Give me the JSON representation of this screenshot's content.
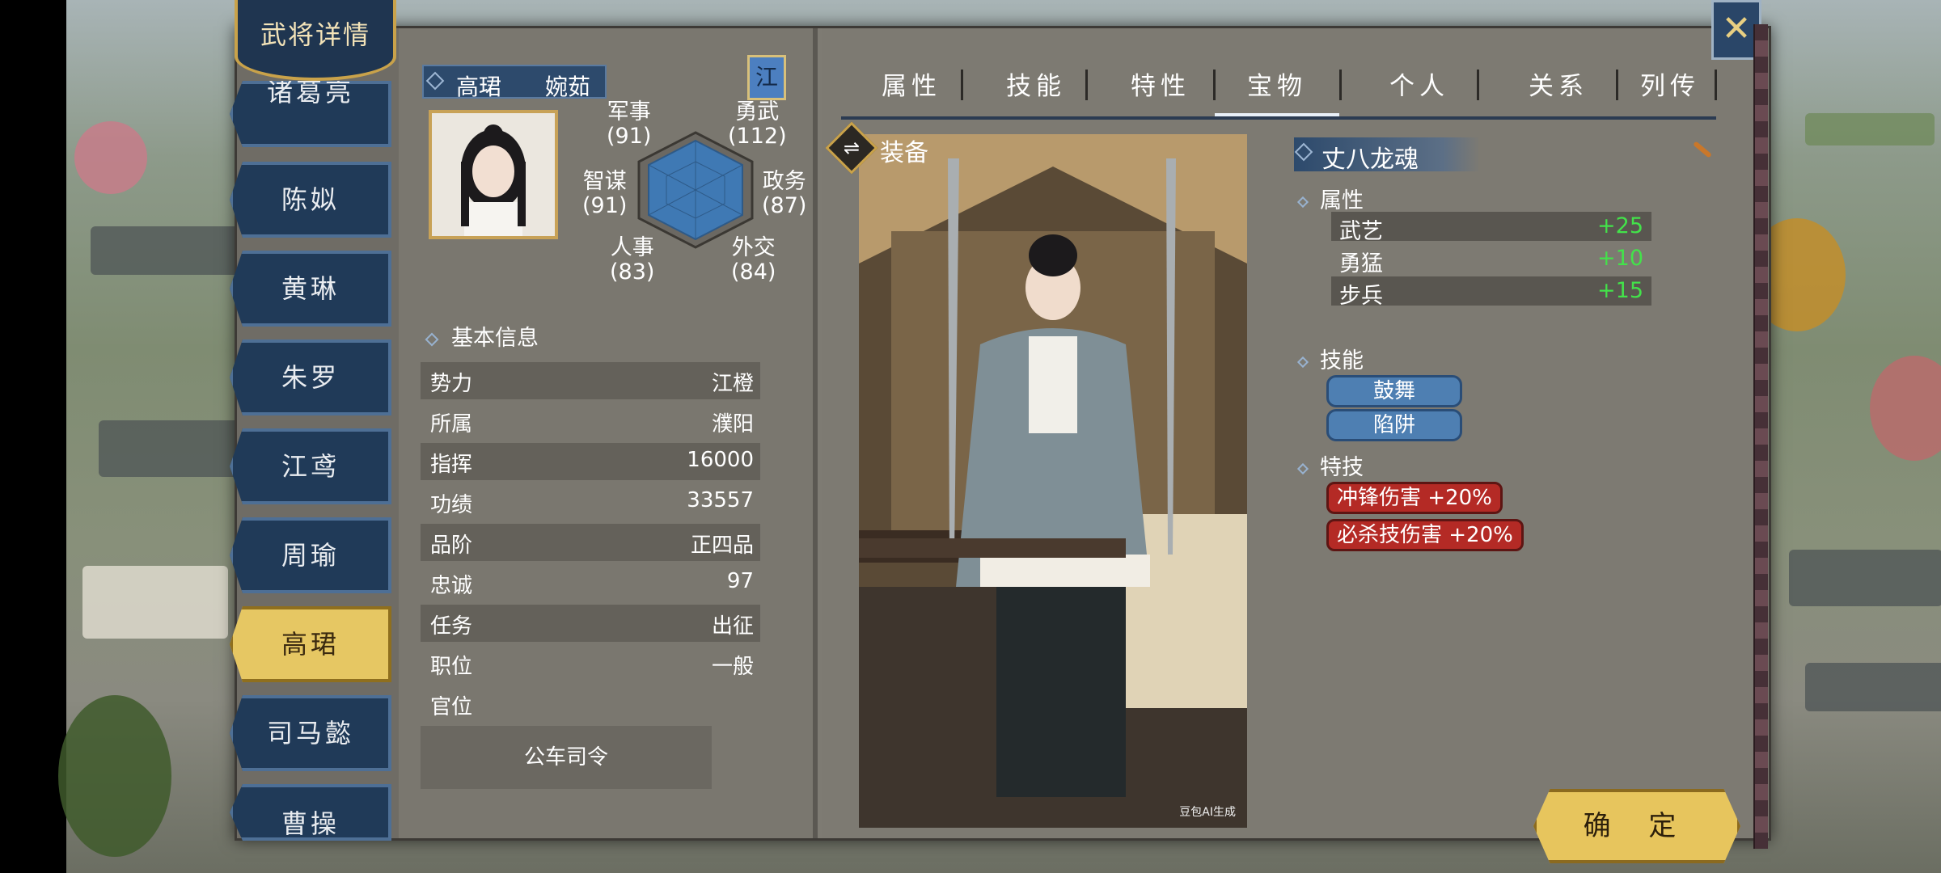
{
  "window_title": "武将详情",
  "officers": [
    {
      "name": "诸葛亮",
      "visible_text": "诸葛亮",
      "active": false
    },
    {
      "name": "陈姒",
      "active": false
    },
    {
      "name": "黄琳",
      "active": false
    },
    {
      "name": "朱罗",
      "active": false
    },
    {
      "name": "江鸢",
      "active": false
    },
    {
      "name": "周瑜",
      "active": false
    },
    {
      "name": "高珺",
      "active": true
    },
    {
      "name": "司马懿",
      "active": false
    },
    {
      "name": "曹操",
      "active": false
    }
  ],
  "officer": {
    "name": "高珺",
    "courtesy": "婉茹",
    "faction_flag": "江",
    "stats": {
      "military": {
        "label": "军事",
        "value": "(91)"
      },
      "valor": {
        "label": "勇武",
        "value": "(112)"
      },
      "strategy": {
        "label": "智谋",
        "value": "(91)"
      },
      "politics": {
        "label": "政务",
        "value": "(87)"
      },
      "personnel": {
        "label": "人事",
        "value": "(83)"
      },
      "diplomacy": {
        "label": "外交",
        "value": "(84)"
      }
    },
    "basic_info_title": "基本信息",
    "basic_info": [
      {
        "k": "势力",
        "v": "江橙"
      },
      {
        "k": "所属",
        "v": "濮阳"
      },
      {
        "k": "指挥",
        "v": "16000"
      },
      {
        "k": "功绩",
        "v": "33557"
      },
      {
        "k": "品阶",
        "v": "正四品"
      },
      {
        "k": "忠诚",
        "v": "97"
      },
      {
        "k": "任务",
        "v": "出征"
      },
      {
        "k": "职位",
        "v": "一般"
      },
      {
        "k": "官位",
        "v": ""
      }
    ],
    "title": "公车司令"
  },
  "tabs": [
    "属性",
    "技能",
    "特性",
    "宝物",
    "个人",
    "关系",
    "列传"
  ],
  "active_tab": "宝物",
  "equipment": {
    "header": "装备",
    "swap_icon": "⇌",
    "watermark": "豆包AI生成",
    "item_name": "丈八龙魂",
    "attr_title": "属性",
    "attributes": [
      {
        "k": "武艺",
        "v": "+25"
      },
      {
        "k": "勇猛",
        "v": "+10"
      },
      {
        "k": "步兵",
        "v": "+15"
      }
    ],
    "skill_title": "技能",
    "skills": [
      "鼓舞",
      "陷阱"
    ],
    "trait_title": "特技",
    "traits": [
      "冲锋伤害 +20%",
      "必杀技伤害 +20%"
    ]
  },
  "confirm_label": "确 定",
  "colors": {
    "accent_gold": "#e7c55d",
    "navy": "#203a58",
    "bonus_green": "#43e24a",
    "trait_red": "#b42a25"
  }
}
